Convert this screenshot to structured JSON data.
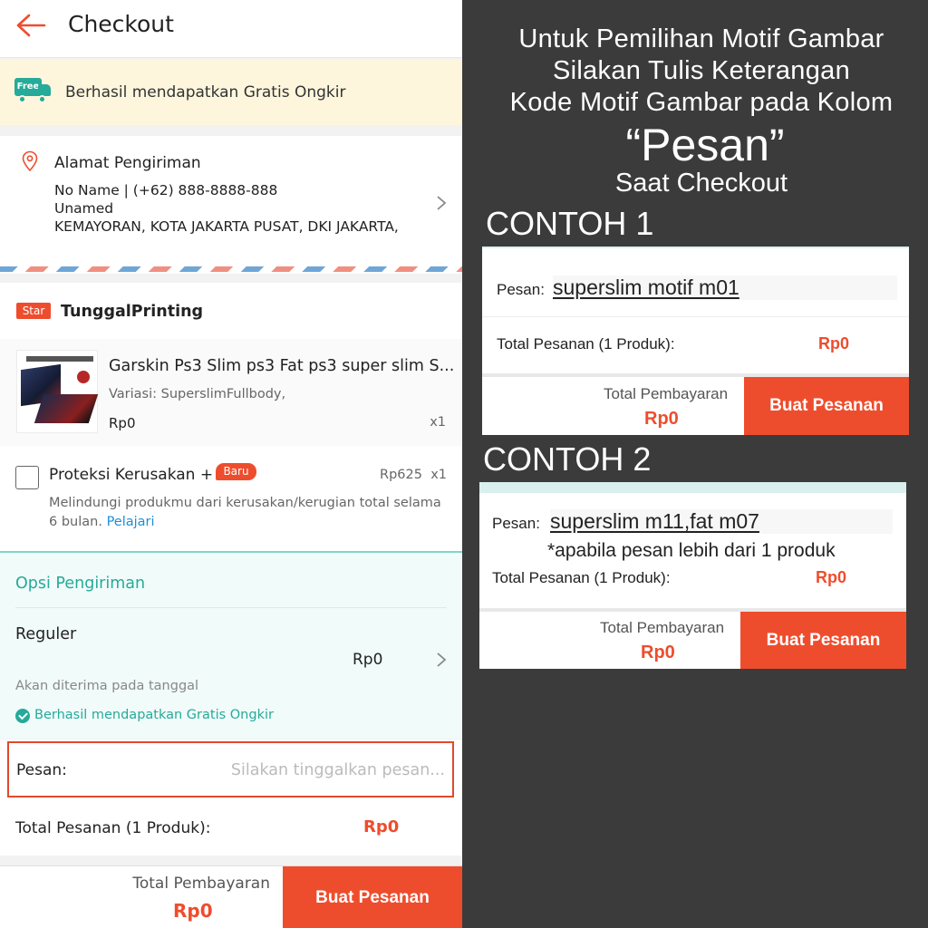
{
  "colors": {
    "accent": "#ee4d2d",
    "teal": "#26aa99",
    "panel_bg": "#3b3b3b"
  },
  "header": {
    "title": "Checkout",
    "back_icon": "arrow-left-icon"
  },
  "free_shipping_bar": {
    "badge": "Free",
    "text": "Berhasil mendapatkan Gratis Ongkir"
  },
  "address": {
    "title": "Alamat Pengiriman",
    "line1": "No Name | (+62) 888-8888-888",
    "line2": "Unamed",
    "line3": "KEMAYORAN, KOTA JAKARTA PUSAT, DKI JAKARTA,"
  },
  "shop": {
    "badge": "Star",
    "name": "TunggalPrinting"
  },
  "product": {
    "name": "Garskin Ps3 Slim ps3 Fat ps3 super slim S...",
    "variant": "Variasi: SuperslimFullbody,",
    "price": "Rp0",
    "qty": "x1"
  },
  "protection": {
    "title": "Proteksi Kerusakan +",
    "badge": "Baru",
    "price": "Rp625",
    "qty": "x1",
    "desc1": "Melindungi produkmu dari kerusakan/kerugian total selama",
    "desc2_prefix": "6 bulan.",
    "desc2_link": "Pelajari"
  },
  "shipping": {
    "title": "Opsi Pengiriman",
    "method": "Reguler",
    "price": "Rp0",
    "eta": "Akan diterima pada tanggal",
    "free_note": "Berhasil mendapatkan Gratis Ongkir"
  },
  "message": {
    "label": "Pesan:",
    "placeholder": "Silakan tinggalkan pesan..."
  },
  "order_total": {
    "label": "Total Pesanan (1 Produk):",
    "value": "Rp0"
  },
  "footer": {
    "total_label": "Total Pembayaran",
    "total_value": "Rp0",
    "button": "Buat Pesanan"
  },
  "instructions": {
    "line1": "Untuk Pemilihan Motif Gambar",
    "line2": "Silakan Tulis Keterangan",
    "line3": "Kode Motif Gambar pada Kolom",
    "line4": "“Pesan”",
    "line5": "Saat Checkout"
  },
  "example1": {
    "heading": "CONTOH 1",
    "msg_label": "Pesan:",
    "msg_value": "superslim motif m01",
    "total_label": "Total Pesanan (1 Produk):",
    "total_value": "Rp0",
    "pay_label": "Total Pembayaran",
    "pay_value": "Rp0",
    "button": "Buat Pesanan"
  },
  "example2": {
    "heading": "CONTOH 2",
    "msg_label": "Pesan:",
    "msg_value": "superslim m11,fat m07",
    "note": "*apabila pesan lebih dari 1 produk",
    "total_label": "Total Pesanan (1 Produk):",
    "total_value": "Rp0",
    "pay_label": "Total Pembayaran",
    "pay_value": "Rp0",
    "button": "Buat Pesanan"
  }
}
